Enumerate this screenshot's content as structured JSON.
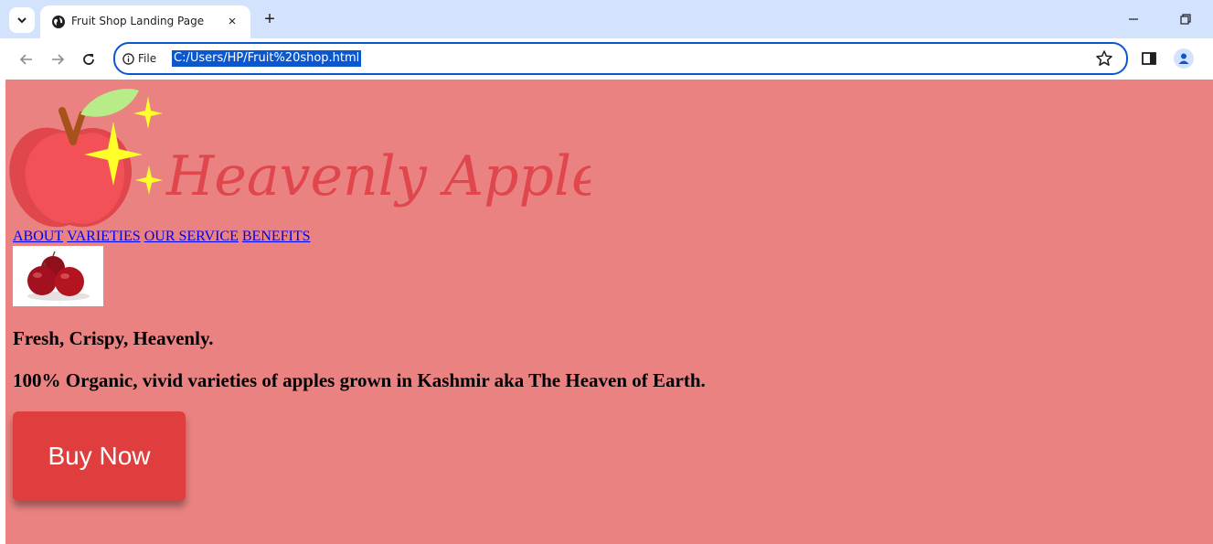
{
  "browser": {
    "tab_title": "Fruit Shop Landing Page",
    "tab_close_glyph": "×",
    "new_tab_glyph": "+",
    "site_info_label": "File",
    "url": "C:/Users/HP/Fruit%20shop.html",
    "icons": [
      "tab-search-icon",
      "globe-icon",
      "close-icon",
      "plus-icon",
      "minimize-icon",
      "restore-icon",
      "back-arrow-icon",
      "forward-arrow-icon",
      "reload-icon",
      "info-icon",
      "star-icon",
      "side-panel-icon",
      "profile-icon"
    ]
  },
  "page": {
    "background": "#eb8282",
    "logo": {
      "text": "Heavenly Apple",
      "text_color": "#e0474c"
    },
    "nav_links": [
      "ABOUT",
      "VARIETIES",
      "OUR SERVICE",
      "BENEFITS"
    ],
    "product_image": "apples-photo",
    "tagline": "Fresh, Crispy, Heavenly.",
    "description": "100% Organic, vivid varieties of apples grown in Kashmir aka The Heaven of Earth.",
    "cta": {
      "label": "Buy Now",
      "color": "#e03e3e"
    }
  }
}
